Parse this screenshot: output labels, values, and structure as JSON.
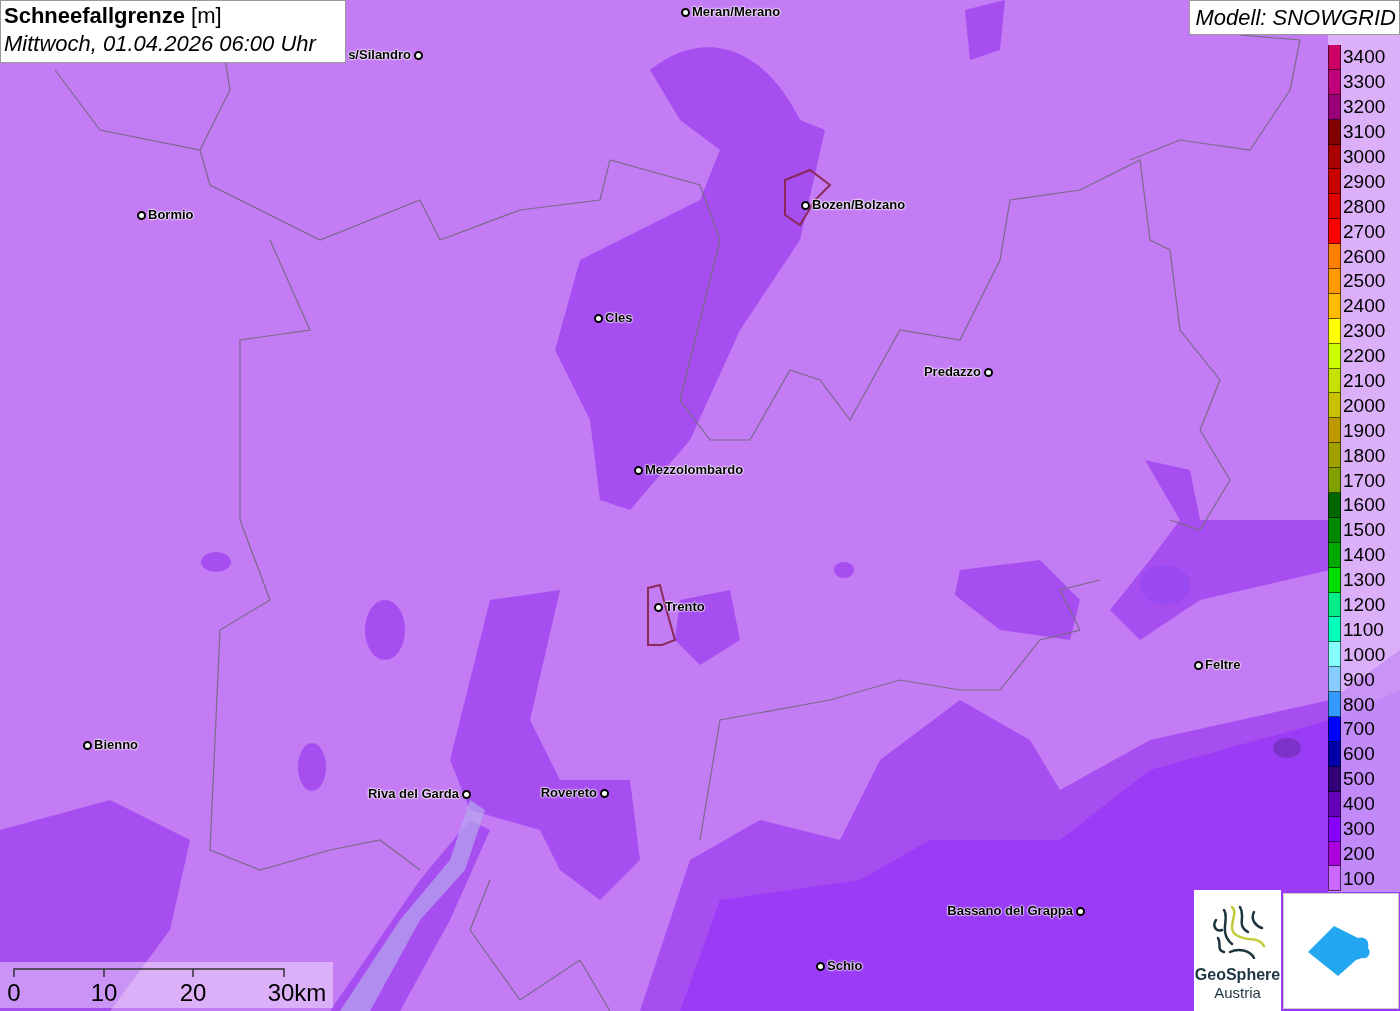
{
  "title": {
    "variable": "Schneefallgrenze",
    "unit": "[m]",
    "time": "Mittwoch, 01.04.2026 06:00 Uhr"
  },
  "model": "Modell: SNOWGRID",
  "cities": [
    {
      "name": "Meran/Merano"
    },
    {
      "name": "s/Silandro"
    },
    {
      "name": "Bormio"
    },
    {
      "name": "Bozen/Bolzano"
    },
    {
      "name": "Cles"
    },
    {
      "name": "Predazzo"
    },
    {
      "name": "Mezzolombardo"
    },
    {
      "name": "Trento"
    },
    {
      "name": "Feltre"
    },
    {
      "name": "Bienno"
    },
    {
      "name": "Riva del Garda"
    },
    {
      "name": "Rovereto"
    },
    {
      "name": "Bassano del Grappa"
    },
    {
      "name": "Schio"
    }
  ],
  "legend": [
    {
      "label": "3400",
      "color": "#cc0066"
    },
    {
      "label": "3300",
      "color": "#c0007a"
    },
    {
      "label": "3200",
      "color": "#990077"
    },
    {
      "label": "3100",
      "color": "#800000"
    },
    {
      "label": "3000",
      "color": "#aa0000"
    },
    {
      "label": "2900",
      "color": "#c80000"
    },
    {
      "label": "2800",
      "color": "#e00000"
    },
    {
      "label": "2700",
      "color": "#ff0000"
    },
    {
      "label": "2600",
      "color": "#ff8000"
    },
    {
      "label": "2500",
      "color": "#ff9900"
    },
    {
      "label": "2400",
      "color": "#ffbb00"
    },
    {
      "label": "2300",
      "color": "#ffff00"
    },
    {
      "label": "2200",
      "color": "#ccff00"
    },
    {
      "label": "2100",
      "color": "#c8e000"
    },
    {
      "label": "2000",
      "color": "#c8c000"
    },
    {
      "label": "1900",
      "color": "#c09800"
    },
    {
      "label": "1800",
      "color": "#a0a000"
    },
    {
      "label": "1700",
      "color": "#80a000"
    },
    {
      "label": "1600",
      "color": "#006600"
    },
    {
      "label": "1500",
      "color": "#008800"
    },
    {
      "label": "1400",
      "color": "#00aa00"
    },
    {
      "label": "1300",
      "color": "#00dd00"
    },
    {
      "label": "1200",
      "color": "#00ee88"
    },
    {
      "label": "1100",
      "color": "#00ffbb"
    },
    {
      "label": "1000",
      "color": "#88ffff"
    },
    {
      "label": "900",
      "color": "#88ccff"
    },
    {
      "label": "800",
      "color": "#3399ff"
    },
    {
      "label": "700",
      "color": "#0000ff"
    },
    {
      "label": "600",
      "color": "#0000aa"
    },
    {
      "label": "500",
      "color": "#330077"
    },
    {
      "label": "400",
      "color": "#6600bb"
    },
    {
      "label": "300",
      "color": "#8800ff"
    },
    {
      "label": "200",
      "color": "#aa00dd"
    },
    {
      "label": "100",
      "color": "#cc66ff"
    }
  ],
  "scale": {
    "ticks": [
      "0",
      "10",
      "20",
      "30km"
    ]
  },
  "logo": {
    "line1": "GeoSphere",
    "line2": "Austria"
  }
}
